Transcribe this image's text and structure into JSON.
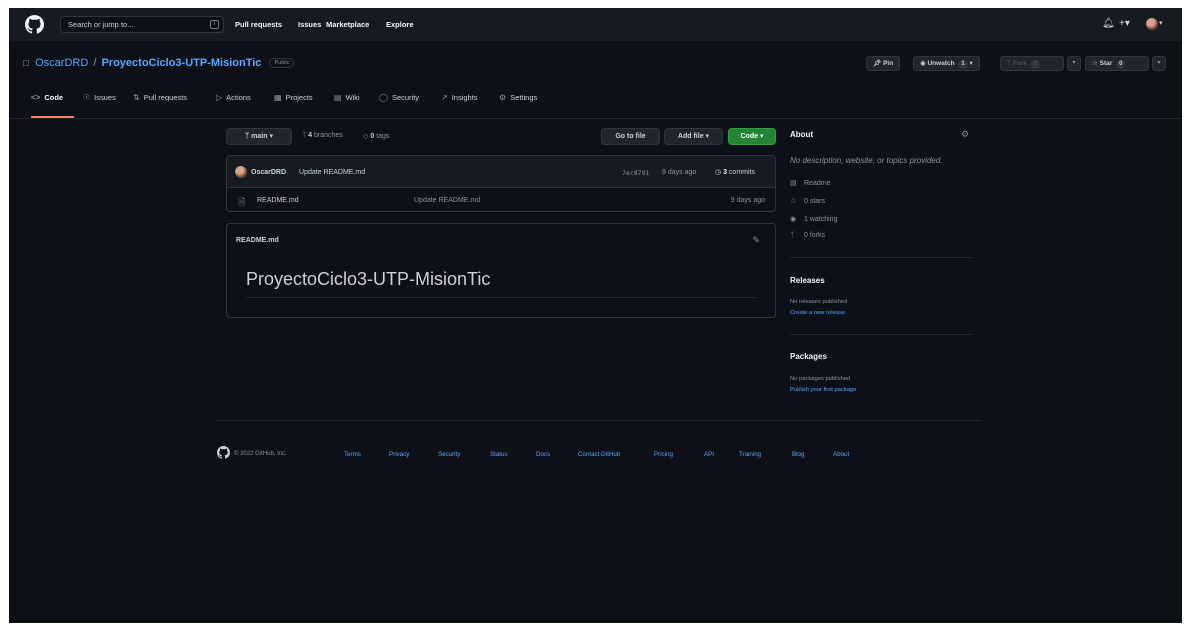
{
  "header": {
    "search_placeholder": "Search or jump to...",
    "search_shortcut": "/",
    "nav": [
      "Pull requests",
      "Issues",
      "Marketplace",
      "Explore"
    ],
    "icons": [
      "bell-icon",
      "plus-icon",
      "avatar"
    ]
  },
  "repo": {
    "owner": "OscarDRD",
    "separator": "/",
    "name": "ProyectoCiclo3-UTP-MisionTic",
    "visibility": "Public",
    "pin_label": "Pin",
    "watch_label": "Unwatch",
    "watch_count": "1",
    "fork_label": "Fork",
    "fork_count": "0",
    "star_label": "Star",
    "star_count": "0"
  },
  "tabs": [
    {
      "label": "Code",
      "icon": "code-icon",
      "active": true
    },
    {
      "label": "Issues",
      "icon": "issue-icon"
    },
    {
      "label": "Pull requests",
      "icon": "pull-request-icon"
    },
    {
      "label": "Actions",
      "icon": "play-icon"
    },
    {
      "label": "Projects",
      "icon": "table-icon"
    },
    {
      "label": "Wiki",
      "icon": "book-icon"
    },
    {
      "label": "Security",
      "icon": "shield-icon"
    },
    {
      "label": "Insights",
      "icon": "graph-icon"
    },
    {
      "label": "Settings",
      "icon": "gear-icon"
    }
  ],
  "branch_bar": {
    "branch": "main",
    "branches_count": "4",
    "branches_label": "branches",
    "tags_count": "0",
    "tags_label": "tags",
    "go_to_file": "Go to file",
    "add_file": "Add file",
    "code": "Code"
  },
  "commit": {
    "author": "OscarDRD",
    "message": "Update README.md",
    "sha": "7ec8791",
    "time": "9 days ago",
    "commits_count": "3",
    "commits_label": "commits"
  },
  "files": [
    {
      "name": "README.md",
      "message": "Update README.md",
      "age": "9 days ago",
      "icon": "file-icon"
    }
  ],
  "readme": {
    "filename": "README.md",
    "heading": "ProyectoCiclo3-UTP-MisionTic"
  },
  "about": {
    "title": "About",
    "description": "No description, website, or topics provided.",
    "stats": [
      {
        "label": "Readme",
        "icon": "book-icon"
      },
      {
        "label": "0 stars",
        "icon": "star-icon"
      },
      {
        "label": "1 watching",
        "icon": "eye-icon"
      },
      {
        "label": "0 forks",
        "icon": "fork-icon"
      }
    ]
  },
  "releases": {
    "title": "Releases",
    "empty": "No releases published",
    "link": "Create a new release"
  },
  "packages": {
    "title": "Packages",
    "empty": "No packages published",
    "link": "Publish your first package"
  },
  "footer": {
    "copyright": "© 2022 GitHub, Inc.",
    "links": [
      "Terms",
      "Privacy",
      "Security",
      "Status",
      "Docs",
      "Contact GitHub",
      "Pricing",
      "API",
      "Training",
      "Blog",
      "About"
    ]
  },
  "colors": {
    "background": "#0d1117",
    "header": "#161b22",
    "link": "#58a6ff",
    "green_button": "#238636",
    "active_tab": "#f78166"
  }
}
